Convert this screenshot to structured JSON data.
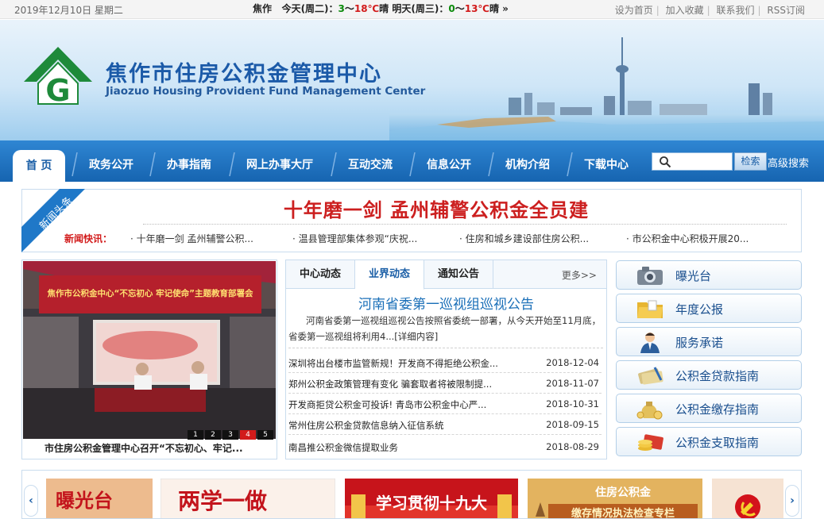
{
  "topbar": {
    "date": "2019年12月10日 星期二",
    "city": "焦作",
    "today_label": "今天(周二)：",
    "today_lo": "3",
    "today_sep": "～",
    "today_hi": "18℃",
    "today_cond": "晴",
    "tomorrow_label": "明天(周三)：",
    "tomorrow_lo": "0",
    "tomorrow_sep": "～",
    "tomorrow_hi": "13℃",
    "tomorrow_cond": "晴",
    "weather_more": "»",
    "links": [
      "设为首页",
      "加入收藏",
      "联系我们",
      "RSS订阅"
    ],
    "link_sep": "|"
  },
  "banner": {
    "title_cn": "焦作市住房公积金管理中心",
    "title_en": "Jiaozuo Housing Provident Fund Management Center",
    "logo_letter": "G"
  },
  "nav": {
    "items": [
      "首 页",
      "政务公开",
      "办事指南",
      "网上办事大厅",
      "互动交流",
      "信息公开",
      "机构介绍",
      "下载中心"
    ],
    "search_placeholder": "",
    "search_button": "检索",
    "advanced": "高级搜索"
  },
  "headline": {
    "ribbon": "新闻头条",
    "title": "十年磨一剑 孟州辅警公积金全员建",
    "ticker_label": "新闻快讯：",
    "ticker": [
      "· 十年磨一剑 孟州辅警公积...",
      "· 温县管理部集体参观“庆祝...",
      "· 住房和城乡建设部住房公积...",
      "· 市公积金中心积极开展20..."
    ]
  },
  "photo": {
    "banner_text": "焦作市公积金中心“不忘初心 牢记使命”主题教育部署会",
    "pages": [
      "1",
      "2",
      "3",
      "4",
      "5"
    ],
    "active_page": 4,
    "caption": "市住房公积金管理中心召开“不忘初心、牢记..."
  },
  "news": {
    "tabs": [
      "中心动态",
      "业界动态",
      "通知公告"
    ],
    "active_tab": 1,
    "more": "更多>>",
    "featured_title": "河南省委第一巡视组巡视公告",
    "featured_summary": "河南省委第一巡视组巡视公告按照省委统一部署，从今天开始至11月底，省委第一巡视组将利用4...",
    "featured_link": "[详细内容]",
    "items": [
      {
        "title": "深圳将出台楼市监管新规！开发商不得拒绝公积金...",
        "date": "2018-12-04"
      },
      {
        "title": "郑州公积金政策管理有变化 骗套取者将被限制提...",
        "date": "2018-11-07"
      },
      {
        "title": "开发商拒贷公积金可投诉! 青岛市公积金中心严...",
        "date": "2018-10-31"
      },
      {
        "title": "常州住房公积金贷款信息纳入征信系统",
        "date": "2018-09-15"
      },
      {
        "title": "南昌推公积金微信提取业务",
        "date": "2018-08-29"
      }
    ]
  },
  "side": {
    "items": [
      {
        "label": "曝光台",
        "icon": "camera-icon"
      },
      {
        "label": "年度公报",
        "icon": "folder-icon"
      },
      {
        "label": "服务承诺",
        "icon": "service-person-icon"
      },
      {
        "label": "公积金贷款指南",
        "icon": "money-pen-icon"
      },
      {
        "label": "公积金缴存指南",
        "icon": "money-bag-icon"
      },
      {
        "label": "公积金支取指南",
        "icon": "coins-card-icon"
      }
    ]
  },
  "strip": {
    "prev": "‹",
    "next": "›",
    "cards": [
      "曝光台",
      "两学一做",
      "学习贯彻十九大",
      "住房公积金",
      "缴存情况执法检查专栏"
    ]
  },
  "colors": {
    "nav_blue": "#1664b0",
    "headline_red": "#cc1f1f",
    "title_blue": "#1b5aa8",
    "weather_green": "#0a8a0a",
    "weather_red": "#d21b1b"
  }
}
